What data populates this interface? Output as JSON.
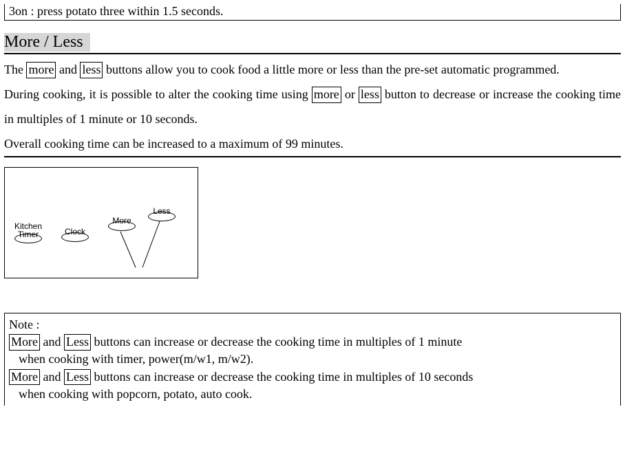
{
  "top_line": "3on : press potato three within 1.5 seconds.",
  "section": {
    "title": "More / Less"
  },
  "body": {
    "p1a": "The ",
    "more1": "more",
    "p1b": " and ",
    "less1": "less",
    "p1c": " buttons allow you to cook food a little more or less than the pre-set automatic programmed.",
    "p2a": "During cooking, it is possible to alter the cooking time using ",
    "more2": "more",
    "p2b": " or ",
    "less2": "less",
    "p2c": "   button to decrease or increase the cooking time in multiples of 1 minute or 10 seconds.",
    "p3": "Overall cooking time can be increased to a maximum of 99 minutes."
  },
  "panel": {
    "kitchen": "Kitchen",
    "timer": "Timer",
    "clock": "Clock",
    "more": "More",
    "less": "Less"
  },
  "note": {
    "heading": "Note :",
    "l1_more": "More",
    "l1_mid": " and ",
    "l1_less": "Less",
    "l1_end": " buttons can increase or decrease the cooking time in multiples of 1 minute",
    "l2": "when cooking with timer, power(m/w1, m/w2).",
    "l3_more": "More",
    "l3_mid": " and ",
    "l3_less": "Less",
    "l3_end": " buttons can increase or decrease the cooking time in multiples of 10 seconds",
    "l4": "when cooking with popcorn, potato, auto cook."
  }
}
